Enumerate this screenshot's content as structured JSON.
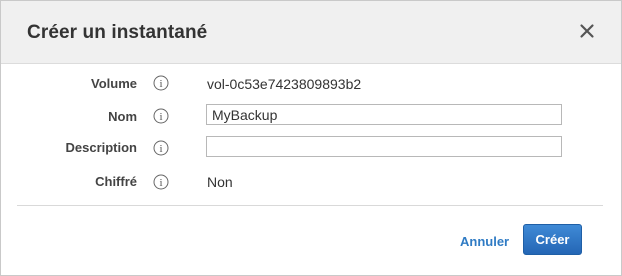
{
  "dialog": {
    "title": "Créer un instantané",
    "close_icon": "close-icon"
  },
  "fields": {
    "volume": {
      "label": "Volume",
      "value": "vol-0c53e7423809893b2",
      "icon": "info-icon"
    },
    "name": {
      "label": "Nom",
      "value": "MyBackup",
      "icon": "info-icon"
    },
    "description": {
      "label": "Description",
      "value": "",
      "icon": "info-icon"
    },
    "encrypted": {
      "label": "Chiffré",
      "value": "Non",
      "icon": "info-icon"
    }
  },
  "footer": {
    "cancel_label": "Annuler",
    "create_label": "Créer"
  },
  "colors": {
    "header_bg": "#f0f0f0",
    "link": "#2f7bc4",
    "primary_button": "#2a6fbf"
  }
}
